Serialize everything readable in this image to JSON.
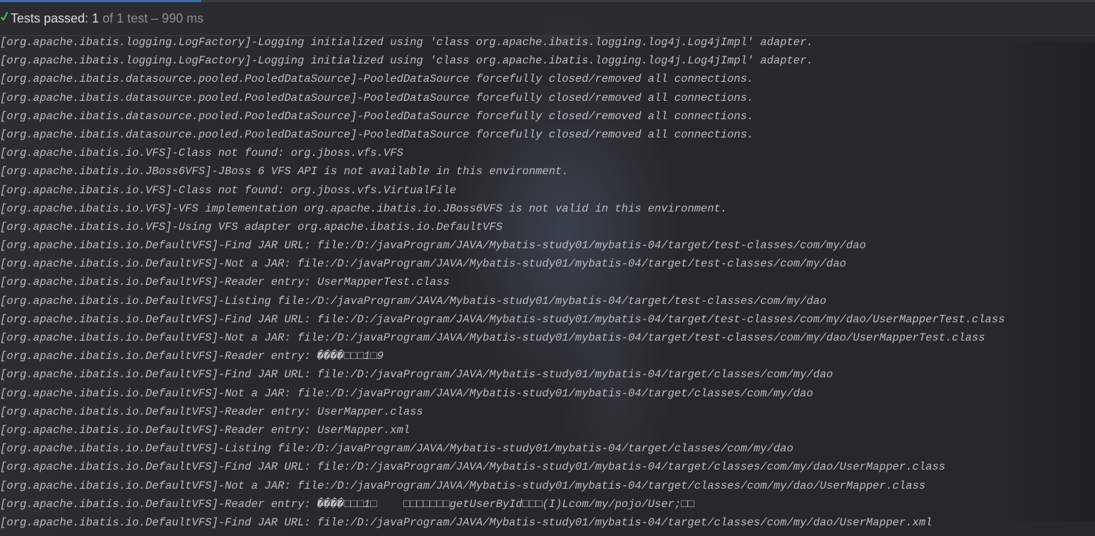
{
  "status": {
    "label": "Tests passed:",
    "count": "1",
    "of_text": "of 1 test",
    "dash": "–",
    "time": "990 ms",
    "check_icon": "checkmark-icon",
    "check_color": "#5fb865"
  },
  "log_lines": [
    "[org.apache.ibatis.logging.LogFactory]-Logging initialized using 'class org.apache.ibatis.logging.log4j.Log4jImpl' adapter.",
    "[org.apache.ibatis.logging.LogFactory]-Logging initialized using 'class org.apache.ibatis.logging.log4j.Log4jImpl' adapter.",
    "[org.apache.ibatis.datasource.pooled.PooledDataSource]-PooledDataSource forcefully closed/removed all connections.",
    "[org.apache.ibatis.datasource.pooled.PooledDataSource]-PooledDataSource forcefully closed/removed all connections.",
    "[org.apache.ibatis.datasource.pooled.PooledDataSource]-PooledDataSource forcefully closed/removed all connections.",
    "[org.apache.ibatis.datasource.pooled.PooledDataSource]-PooledDataSource forcefully closed/removed all connections.",
    "[org.apache.ibatis.io.VFS]-Class not found: org.jboss.vfs.VFS",
    "[org.apache.ibatis.io.JBoss6VFS]-JBoss 6 VFS API is not available in this environment.",
    "[org.apache.ibatis.io.VFS]-Class not found: org.jboss.vfs.VirtualFile",
    "[org.apache.ibatis.io.VFS]-VFS implementation org.apache.ibatis.io.JBoss6VFS is not valid in this environment.",
    "[org.apache.ibatis.io.VFS]-Using VFS adapter org.apache.ibatis.io.DefaultVFS",
    "[org.apache.ibatis.io.DefaultVFS]-Find JAR URL: file:/D:/javaProgram/JAVA/Mybatis-study01/mybatis-04/target/test-classes/com/my/dao",
    "[org.apache.ibatis.io.DefaultVFS]-Not a JAR: file:/D:/javaProgram/JAVA/Mybatis-study01/mybatis-04/target/test-classes/com/my/dao",
    "[org.apache.ibatis.io.DefaultVFS]-Reader entry: UserMapperTest.class",
    "[org.apache.ibatis.io.DefaultVFS]-Listing file:/D:/javaProgram/JAVA/Mybatis-study01/mybatis-04/target/test-classes/com/my/dao",
    "[org.apache.ibatis.io.DefaultVFS]-Find JAR URL: file:/D:/javaProgram/JAVA/Mybatis-study01/mybatis-04/target/test-classes/com/my/dao/UserMapperTest.class",
    "[org.apache.ibatis.io.DefaultVFS]-Not a JAR: file:/D:/javaProgram/JAVA/Mybatis-study01/mybatis-04/target/test-classes/com/my/dao/UserMapperTest.class",
    "[org.apache.ibatis.io.DefaultVFS]-Reader entry: ����□□□1□9",
    "[org.apache.ibatis.io.DefaultVFS]-Find JAR URL: file:/D:/javaProgram/JAVA/Mybatis-study01/mybatis-04/target/classes/com/my/dao",
    "[org.apache.ibatis.io.DefaultVFS]-Not a JAR: file:/D:/javaProgram/JAVA/Mybatis-study01/mybatis-04/target/classes/com/my/dao",
    "[org.apache.ibatis.io.DefaultVFS]-Reader entry: UserMapper.class",
    "[org.apache.ibatis.io.DefaultVFS]-Reader entry: UserMapper.xml",
    "[org.apache.ibatis.io.DefaultVFS]-Listing file:/D:/javaProgram/JAVA/Mybatis-study01/mybatis-04/target/classes/com/my/dao",
    "[org.apache.ibatis.io.DefaultVFS]-Find JAR URL: file:/D:/javaProgram/JAVA/Mybatis-study01/mybatis-04/target/classes/com/my/dao/UserMapper.class",
    "[org.apache.ibatis.io.DefaultVFS]-Not a JAR: file:/D:/javaProgram/JAVA/Mybatis-study01/mybatis-04/target/classes/com/my/dao/UserMapper.class",
    "[org.apache.ibatis.io.DefaultVFS]-Reader entry: ����□□□1□    □□□□□□□getUserById□□□(I)Lcom/my/pojo/User;□□",
    "[org.apache.ibatis.io.DefaultVFS]-Find JAR URL: file:/D:/javaProgram/JAVA/Mybatis-study01/mybatis-04/target/classes/com/my/dao/UserMapper.xml"
  ]
}
